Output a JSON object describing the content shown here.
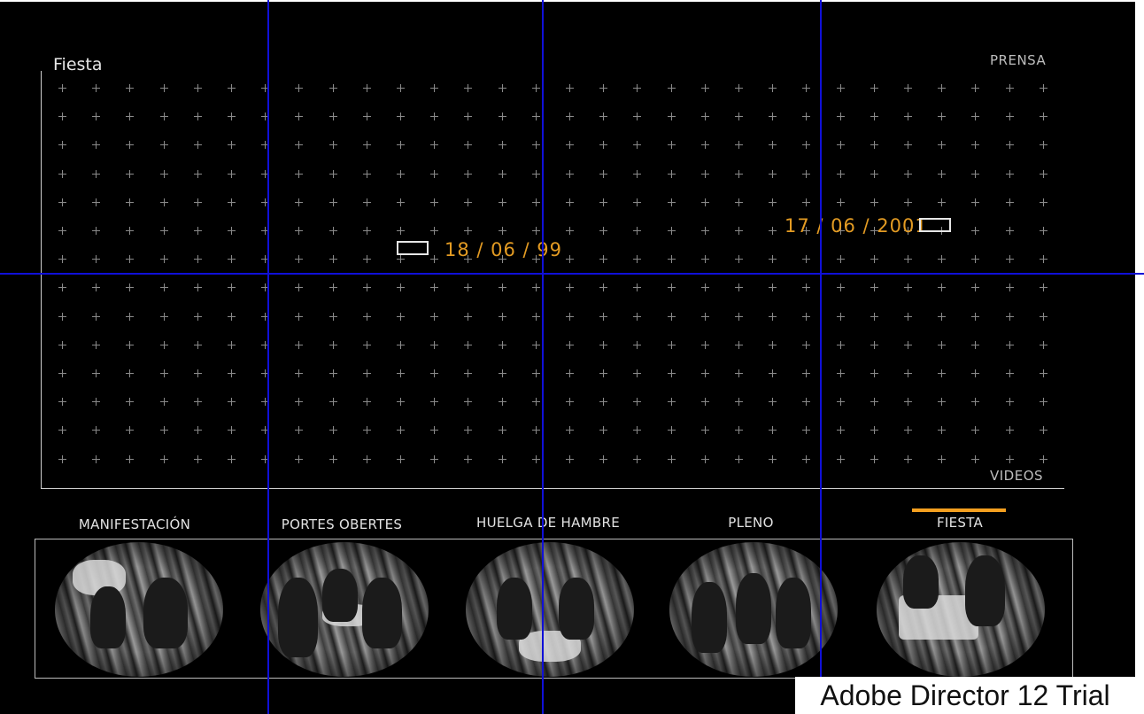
{
  "timeline": {
    "section_title": "Fiesta",
    "top_label": "PRENSA",
    "bottom_label": "VIDEOS",
    "events": [
      {
        "date": "18 / 06 / 99"
      },
      {
        "date": "17 / 06 / 2001"
      }
    ]
  },
  "categories": [
    {
      "label": "MANIFESTACIÓN",
      "active": false
    },
    {
      "label": "PORTES OBERTES",
      "active": false
    },
    {
      "label": "HUELGA DE HAMBRE",
      "active": false
    },
    {
      "label": "PLENO",
      "active": false
    },
    {
      "label": "FIESTA",
      "active": true
    }
  ],
  "watermark": "Adobe Director 12 Trial",
  "colors": {
    "background": "#000000",
    "accent": "#f4a020",
    "event_date": "#e39b23",
    "guide": "#1010d8"
  }
}
